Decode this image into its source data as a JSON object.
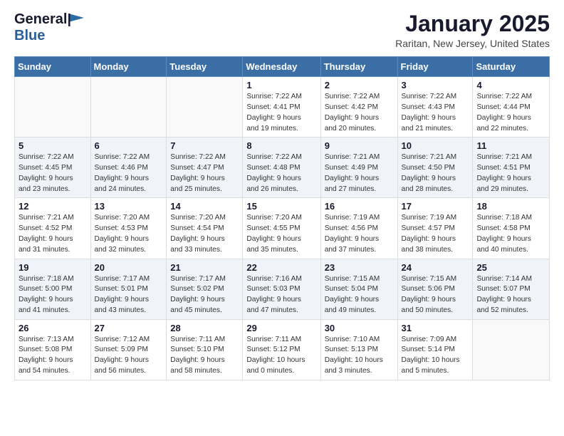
{
  "header": {
    "logo_general": "General",
    "logo_blue": "Blue",
    "month_title": "January 2025",
    "location": "Raritan, New Jersey, United States"
  },
  "weekdays": [
    "Sunday",
    "Monday",
    "Tuesday",
    "Wednesday",
    "Thursday",
    "Friday",
    "Saturday"
  ],
  "weeks": [
    [
      {
        "day": "",
        "info": ""
      },
      {
        "day": "",
        "info": ""
      },
      {
        "day": "",
        "info": ""
      },
      {
        "day": "1",
        "info": "Sunrise: 7:22 AM\nSunset: 4:41 PM\nDaylight: 9 hours\nand 19 minutes."
      },
      {
        "day": "2",
        "info": "Sunrise: 7:22 AM\nSunset: 4:42 PM\nDaylight: 9 hours\nand 20 minutes."
      },
      {
        "day": "3",
        "info": "Sunrise: 7:22 AM\nSunset: 4:43 PM\nDaylight: 9 hours\nand 21 minutes."
      },
      {
        "day": "4",
        "info": "Sunrise: 7:22 AM\nSunset: 4:44 PM\nDaylight: 9 hours\nand 22 minutes."
      }
    ],
    [
      {
        "day": "5",
        "info": "Sunrise: 7:22 AM\nSunset: 4:45 PM\nDaylight: 9 hours\nand 23 minutes."
      },
      {
        "day": "6",
        "info": "Sunrise: 7:22 AM\nSunset: 4:46 PM\nDaylight: 9 hours\nand 24 minutes."
      },
      {
        "day": "7",
        "info": "Sunrise: 7:22 AM\nSunset: 4:47 PM\nDaylight: 9 hours\nand 25 minutes."
      },
      {
        "day": "8",
        "info": "Sunrise: 7:22 AM\nSunset: 4:48 PM\nDaylight: 9 hours\nand 26 minutes."
      },
      {
        "day": "9",
        "info": "Sunrise: 7:21 AM\nSunset: 4:49 PM\nDaylight: 9 hours\nand 27 minutes."
      },
      {
        "day": "10",
        "info": "Sunrise: 7:21 AM\nSunset: 4:50 PM\nDaylight: 9 hours\nand 28 minutes."
      },
      {
        "day": "11",
        "info": "Sunrise: 7:21 AM\nSunset: 4:51 PM\nDaylight: 9 hours\nand 29 minutes."
      }
    ],
    [
      {
        "day": "12",
        "info": "Sunrise: 7:21 AM\nSunset: 4:52 PM\nDaylight: 9 hours\nand 31 minutes."
      },
      {
        "day": "13",
        "info": "Sunrise: 7:20 AM\nSunset: 4:53 PM\nDaylight: 9 hours\nand 32 minutes."
      },
      {
        "day": "14",
        "info": "Sunrise: 7:20 AM\nSunset: 4:54 PM\nDaylight: 9 hours\nand 33 minutes."
      },
      {
        "day": "15",
        "info": "Sunrise: 7:20 AM\nSunset: 4:55 PM\nDaylight: 9 hours\nand 35 minutes."
      },
      {
        "day": "16",
        "info": "Sunrise: 7:19 AM\nSunset: 4:56 PM\nDaylight: 9 hours\nand 37 minutes."
      },
      {
        "day": "17",
        "info": "Sunrise: 7:19 AM\nSunset: 4:57 PM\nDaylight: 9 hours\nand 38 minutes."
      },
      {
        "day": "18",
        "info": "Sunrise: 7:18 AM\nSunset: 4:58 PM\nDaylight: 9 hours\nand 40 minutes."
      }
    ],
    [
      {
        "day": "19",
        "info": "Sunrise: 7:18 AM\nSunset: 5:00 PM\nDaylight: 9 hours\nand 41 minutes."
      },
      {
        "day": "20",
        "info": "Sunrise: 7:17 AM\nSunset: 5:01 PM\nDaylight: 9 hours\nand 43 minutes."
      },
      {
        "day": "21",
        "info": "Sunrise: 7:17 AM\nSunset: 5:02 PM\nDaylight: 9 hours\nand 45 minutes."
      },
      {
        "day": "22",
        "info": "Sunrise: 7:16 AM\nSunset: 5:03 PM\nDaylight: 9 hours\nand 47 minutes."
      },
      {
        "day": "23",
        "info": "Sunrise: 7:15 AM\nSunset: 5:04 PM\nDaylight: 9 hours\nand 49 minutes."
      },
      {
        "day": "24",
        "info": "Sunrise: 7:15 AM\nSunset: 5:06 PM\nDaylight: 9 hours\nand 50 minutes."
      },
      {
        "day": "25",
        "info": "Sunrise: 7:14 AM\nSunset: 5:07 PM\nDaylight: 9 hours\nand 52 minutes."
      }
    ],
    [
      {
        "day": "26",
        "info": "Sunrise: 7:13 AM\nSunset: 5:08 PM\nDaylight: 9 hours\nand 54 minutes."
      },
      {
        "day": "27",
        "info": "Sunrise: 7:12 AM\nSunset: 5:09 PM\nDaylight: 9 hours\nand 56 minutes."
      },
      {
        "day": "28",
        "info": "Sunrise: 7:11 AM\nSunset: 5:10 PM\nDaylight: 9 hours\nand 58 minutes."
      },
      {
        "day": "29",
        "info": "Sunrise: 7:11 AM\nSunset: 5:12 PM\nDaylight: 10 hours\nand 0 minutes."
      },
      {
        "day": "30",
        "info": "Sunrise: 7:10 AM\nSunset: 5:13 PM\nDaylight: 10 hours\nand 3 minutes."
      },
      {
        "day": "31",
        "info": "Sunrise: 7:09 AM\nSunset: 5:14 PM\nDaylight: 10 hours\nand 5 minutes."
      },
      {
        "day": "",
        "info": ""
      }
    ]
  ]
}
